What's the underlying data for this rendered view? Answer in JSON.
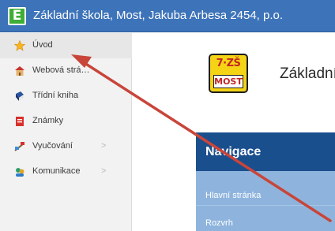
{
  "header": {
    "logo_letter": "E",
    "title": "Základní škola, Most, Jakuba Arbesa 2454, p.o."
  },
  "sidebar": {
    "items": [
      {
        "label": "Úvod",
        "icon": "star-icon",
        "has_submenu": false,
        "active": true
      },
      {
        "label": "Webová strá…",
        "icon": "school-icon",
        "has_submenu": false,
        "active": false
      },
      {
        "label": "Třídní kniha",
        "icon": "book-icon",
        "has_submenu": false,
        "active": false
      },
      {
        "label": "Známky",
        "icon": "grades-icon",
        "has_submenu": false,
        "active": false
      },
      {
        "label": "Vyučování",
        "icon": "teaching-icon",
        "has_submenu": true,
        "active": false
      },
      {
        "label": "Komunikace",
        "icon": "people-icon",
        "has_submenu": true,
        "active": false
      }
    ]
  },
  "main": {
    "logo_line1": "7·ZŠ",
    "logo_line2": "MOST",
    "heading": "Základní",
    "panel": {
      "title": "Navigace",
      "links": [
        "Hlavní stránka",
        "Rozvrh"
      ]
    }
  },
  "colors": {
    "topbar": "#3d73b9",
    "panel_header": "#1a4f8e",
    "panel_body": "#8eb4dd",
    "arrow": "#c8453a"
  }
}
